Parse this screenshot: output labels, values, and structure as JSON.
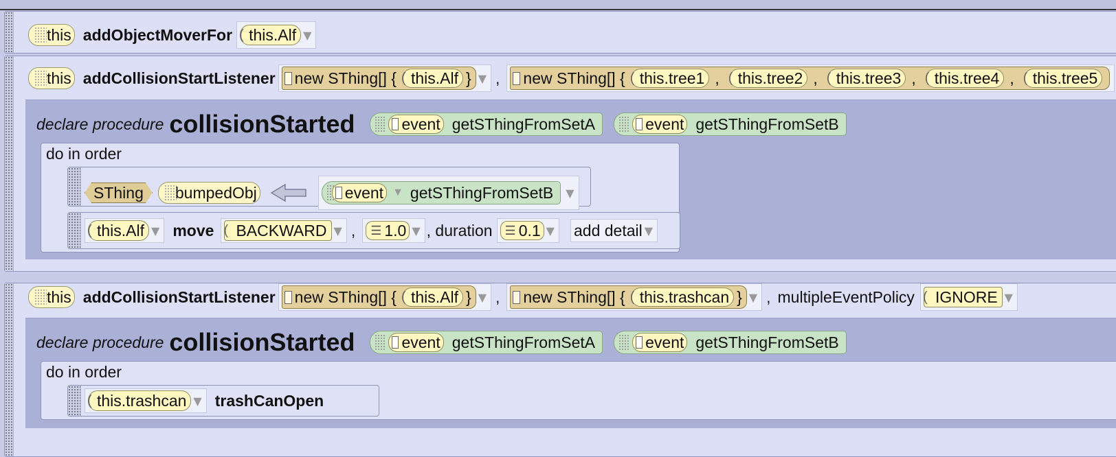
{
  "statement1": {
    "target": "this",
    "method": "addObjectMoverFor",
    "arg": "this.Alf"
  },
  "statement2": {
    "target": "this",
    "method": "addCollisionStartListener",
    "setA_label": "new SThing[] {",
    "setA_items": [
      "this.Alf"
    ],
    "setA_close": "}",
    "setB_label": "new SThing[] {",
    "setB_items": [
      "this.tree1",
      "this.tree2",
      "this.tree3",
      "this.tree4",
      "this.tree5"
    ],
    "separator": ",",
    "procedure": {
      "declare": "declare procedure",
      "name": "collisionStarted",
      "params": [
        {
          "object": "event",
          "method": "getSThingFromSetA"
        },
        {
          "object": "event",
          "method": "getSThingFromSetB"
        }
      ],
      "do_in_order": "do in order",
      "local": {
        "type": "SThing",
        "name": "bumpedObj",
        "value_object": "event",
        "value_method": "getSThingFromSetB"
      },
      "move": {
        "target": "this.Alf",
        "method": "move",
        "direction": "BACKWARD",
        "amount": "1.0",
        "duration_label": ", duration",
        "duration": "0.1",
        "add_detail": "add detail"
      }
    }
  },
  "statement3": {
    "target": "this",
    "method": "addCollisionStartListener",
    "setA_label": "new SThing[] {",
    "setA_items": [
      "this.Alf"
    ],
    "setA_close": "}",
    "setB_label": "new SThing[] {",
    "setB_items": [
      "this.trashcan"
    ],
    "setB_close": "}",
    "policy_label": "multipleEventPolicy",
    "policy_value": "IGNORE",
    "procedure": {
      "declare": "declare procedure",
      "name": "collisionStarted",
      "params": [
        {
          "object": "event",
          "method": "getSThingFromSetA"
        },
        {
          "object": "event",
          "method": "getSThingFromSetB"
        }
      ],
      "do_in_order": "do in order",
      "call": {
        "target": "this.trashcan",
        "method": "trashCanOpen"
      }
    }
  },
  "colors": {
    "statement_bg": "#dcdff6",
    "procedure_bg": "#aab0d6",
    "object_pill": "#fff6c0",
    "array_box": "#e4d09c",
    "event_param": "#c9e3c6"
  }
}
